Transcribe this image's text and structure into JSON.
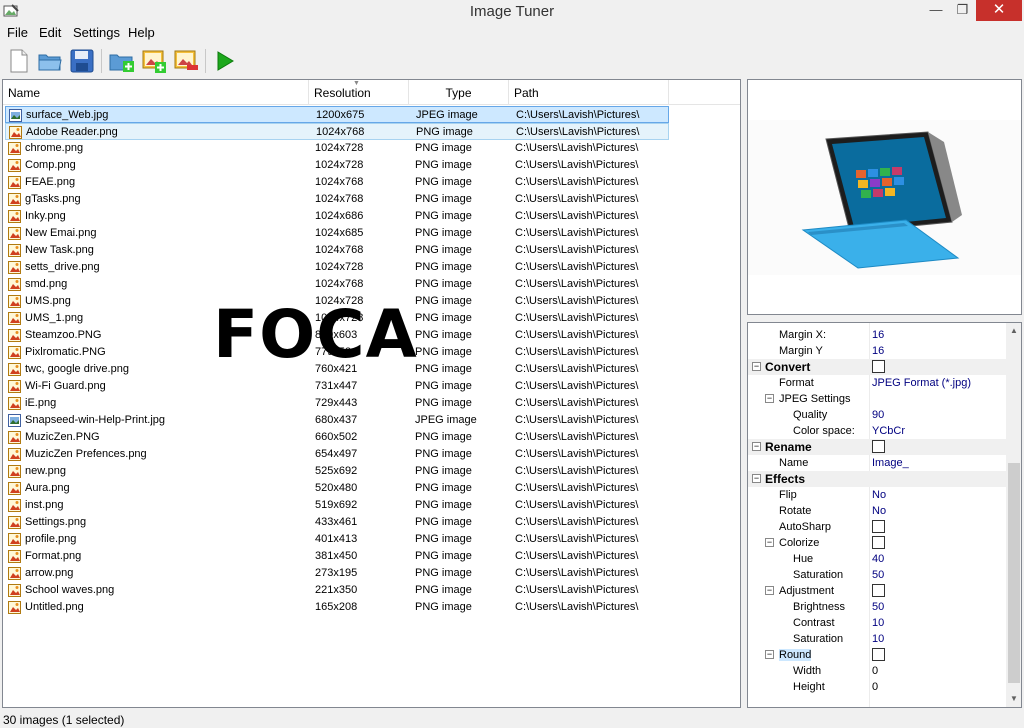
{
  "window": {
    "title": "Image Tuner",
    "minimize": "—",
    "restore": "❐",
    "close": "✕"
  },
  "menu": [
    "File",
    "Edit",
    "Settings",
    "Help"
  ],
  "toolbar": [
    "new-icon",
    "open-folder-icon",
    "save-icon",
    "add-folder-icon",
    "add-image-icon",
    "remove-image-icon",
    "run-icon"
  ],
  "columns": {
    "name": "Name",
    "resolution": "Resolution",
    "type": "Type",
    "path": "Path"
  },
  "files": [
    {
      "name": "surface_Web.jpg",
      "resolution": "1200x675",
      "type": "JPEG image",
      "path": "C:\\Users\\Lavish\\Pictures\\",
      "icon": "jpeg"
    },
    {
      "name": "Adobe Reader.png",
      "resolution": "1024x768",
      "type": "PNG image",
      "path": "C:\\Users\\Lavish\\Pictures\\",
      "icon": "png"
    },
    {
      "name": "chrome.png",
      "resolution": "1024x728",
      "type": "PNG image",
      "path": "C:\\Users\\Lavish\\Pictures\\",
      "icon": "png"
    },
    {
      "name": "Comp.png",
      "resolution": "1024x728",
      "type": "PNG image",
      "path": "C:\\Users\\Lavish\\Pictures\\",
      "icon": "png"
    },
    {
      "name": "FEAE.png",
      "resolution": "1024x768",
      "type": "PNG image",
      "path": "C:\\Users\\Lavish\\Pictures\\",
      "icon": "png"
    },
    {
      "name": "gTasks.png",
      "resolution": "1024x768",
      "type": "PNG image",
      "path": "C:\\Users\\Lavish\\Pictures\\",
      "icon": "png"
    },
    {
      "name": "Inky.png",
      "resolution": "1024x686",
      "type": "PNG image",
      "path": "C:\\Users\\Lavish\\Pictures\\",
      "icon": "png"
    },
    {
      "name": "New Emai.png",
      "resolution": "1024x685",
      "type": "PNG image",
      "path": "C:\\Users\\Lavish\\Pictures\\",
      "icon": "png"
    },
    {
      "name": "New Task.png",
      "resolution": "1024x768",
      "type": "PNG image",
      "path": "C:\\Users\\Lavish\\Pictures\\",
      "icon": "png"
    },
    {
      "name": "setts_drive.png",
      "resolution": "1024x728",
      "type": "PNG image",
      "path": "C:\\Users\\Lavish\\Pictures\\",
      "icon": "png"
    },
    {
      "name": "smd.png",
      "resolution": "1024x768",
      "type": "PNG image",
      "path": "C:\\Users\\Lavish\\Pictures\\",
      "icon": "png"
    },
    {
      "name": "UMS.png",
      "resolution": "1024x728",
      "type": "PNG image",
      "path": "C:\\Users\\Lavish\\Pictures\\",
      "icon": "png"
    },
    {
      "name": "UMS_1.png",
      "resolution": "1024x728",
      "type": "PNG image",
      "path": "C:\\Users\\Lavish\\Pictures\\",
      "icon": "png"
    },
    {
      "name": "Steamzoo.PNG",
      "resolution": "829x603",
      "type": "PNG image",
      "path": "C:\\Users\\Lavish\\Pictures\\",
      "icon": "png"
    },
    {
      "name": "Pixlromatic.PNG",
      "resolution": "779x584",
      "type": "PNG image",
      "path": "C:\\Users\\Lavish\\Pictures\\",
      "icon": "png"
    },
    {
      "name": "twc, google drive.png",
      "resolution": "760x421",
      "type": "PNG image",
      "path": "C:\\Users\\Lavish\\Pictures\\",
      "icon": "png"
    },
    {
      "name": "Wi-Fi Guard.png",
      "resolution": "731x447",
      "type": "PNG image",
      "path": "C:\\Users\\Lavish\\Pictures\\",
      "icon": "png"
    },
    {
      "name": "iE.png",
      "resolution": "729x443",
      "type": "PNG image",
      "path": "C:\\Users\\Lavish\\Pictures\\",
      "icon": "png"
    },
    {
      "name": "Snapseed-win-Help-Print.jpg",
      "resolution": "680x437",
      "type": "JPEG image",
      "path": "C:\\Users\\Lavish\\Pictures\\",
      "icon": "jpeg"
    },
    {
      "name": "MuzicZen.PNG",
      "resolution": "660x502",
      "type": "PNG image",
      "path": "C:\\Users\\Lavish\\Pictures\\",
      "icon": "png"
    },
    {
      "name": "MuzicZen Prefences.png",
      "resolution": "654x497",
      "type": "PNG image",
      "path": "C:\\Users\\Lavish\\Pictures\\",
      "icon": "png"
    },
    {
      "name": "new.png",
      "resolution": "525x692",
      "type": "PNG image",
      "path": "C:\\Users\\Lavish\\Pictures\\",
      "icon": "png"
    },
    {
      "name": "Aura.png",
      "resolution": "520x480",
      "type": "PNG image",
      "path": "C:\\Users\\Lavish\\Pictures\\",
      "icon": "png"
    },
    {
      "name": "inst.png",
      "resolution": "519x692",
      "type": "PNG image",
      "path": "C:\\Users\\Lavish\\Pictures\\",
      "icon": "png"
    },
    {
      "name": "Settings.png",
      "resolution": "433x461",
      "type": "PNG image",
      "path": "C:\\Users\\Lavish\\Pictures\\",
      "icon": "png"
    },
    {
      "name": "profile.png",
      "resolution": "401x413",
      "type": "PNG image",
      "path": "C:\\Users\\Lavish\\Pictures\\",
      "icon": "png"
    },
    {
      "name": "Format.png",
      "resolution": "381x450",
      "type": "PNG image",
      "path": "C:\\Users\\Lavish\\Pictures\\",
      "icon": "png"
    },
    {
      "name": "arrow.png",
      "resolution": "273x195",
      "type": "PNG image",
      "path": "C:\\Users\\Lavish\\Pictures\\",
      "icon": "png"
    },
    {
      "name": "School waves.png",
      "resolution": "221x350",
      "type": "PNG image",
      "path": "C:\\Users\\Lavish\\Pictures\\",
      "icon": "png"
    },
    {
      "name": "Untitled.png",
      "resolution": "165x208",
      "type": "PNG image",
      "path": "C:\\Users\\Lavish\\Pictures\\",
      "icon": "png"
    }
  ],
  "selected_index": 0,
  "hover_index": 1,
  "watermark": "FOCA",
  "properties": [
    {
      "kind": "prop",
      "level": 2,
      "label": "Margin X:",
      "value": "16"
    },
    {
      "kind": "prop",
      "level": 2,
      "label": "Margin Y",
      "value": "16"
    },
    {
      "kind": "cat",
      "label": "Convert",
      "checkbox": true
    },
    {
      "kind": "prop",
      "level": 2,
      "label": "Format",
      "value": "JPEG Format (*.jpg)"
    },
    {
      "kind": "group",
      "level": 2,
      "label": "JPEG Settings"
    },
    {
      "kind": "prop",
      "level": 3,
      "label": "Quality",
      "value": "90"
    },
    {
      "kind": "prop",
      "level": 3,
      "label": "Color space:",
      "value": "YCbCr"
    },
    {
      "kind": "cat",
      "label": "Rename",
      "checkbox": true
    },
    {
      "kind": "prop",
      "level": 2,
      "label": "Name",
      "value": "Image_"
    },
    {
      "kind": "cat",
      "label": "Effects"
    },
    {
      "kind": "prop",
      "level": 2,
      "label": "Flip",
      "value": "No"
    },
    {
      "kind": "prop",
      "level": 2,
      "label": "Rotate",
      "value": "No"
    },
    {
      "kind": "prop",
      "level": 2,
      "label": "AutoSharp",
      "checkbox": true
    },
    {
      "kind": "group",
      "level": 2,
      "label": "Colorize",
      "checkbox": true
    },
    {
      "kind": "prop",
      "level": 3,
      "label": "Hue",
      "value": "40"
    },
    {
      "kind": "prop",
      "level": 3,
      "label": "Saturation",
      "value": "50"
    },
    {
      "kind": "group",
      "level": 2,
      "label": "Adjustment",
      "checkbox": true
    },
    {
      "kind": "prop",
      "level": 3,
      "label": "Brightness",
      "value": "50"
    },
    {
      "kind": "prop",
      "level": 3,
      "label": "Contrast",
      "value": "10"
    },
    {
      "kind": "prop",
      "level": 3,
      "label": "Saturation",
      "value": "10"
    },
    {
      "kind": "group",
      "level": 2,
      "label": "Round",
      "checkbox": true,
      "selected": true
    },
    {
      "kind": "prop",
      "level": 3,
      "label": "Width",
      "value": "0",
      "plain": true
    },
    {
      "kind": "prop",
      "level": 3,
      "label": "Height",
      "value": "0",
      "plain": true
    }
  ],
  "status": "30 images (1 selected)",
  "colors": {
    "selection": "#cde8ff",
    "selection_border": "#66a7e8",
    "value_text": "#000080",
    "close_button": "#c7302b"
  }
}
